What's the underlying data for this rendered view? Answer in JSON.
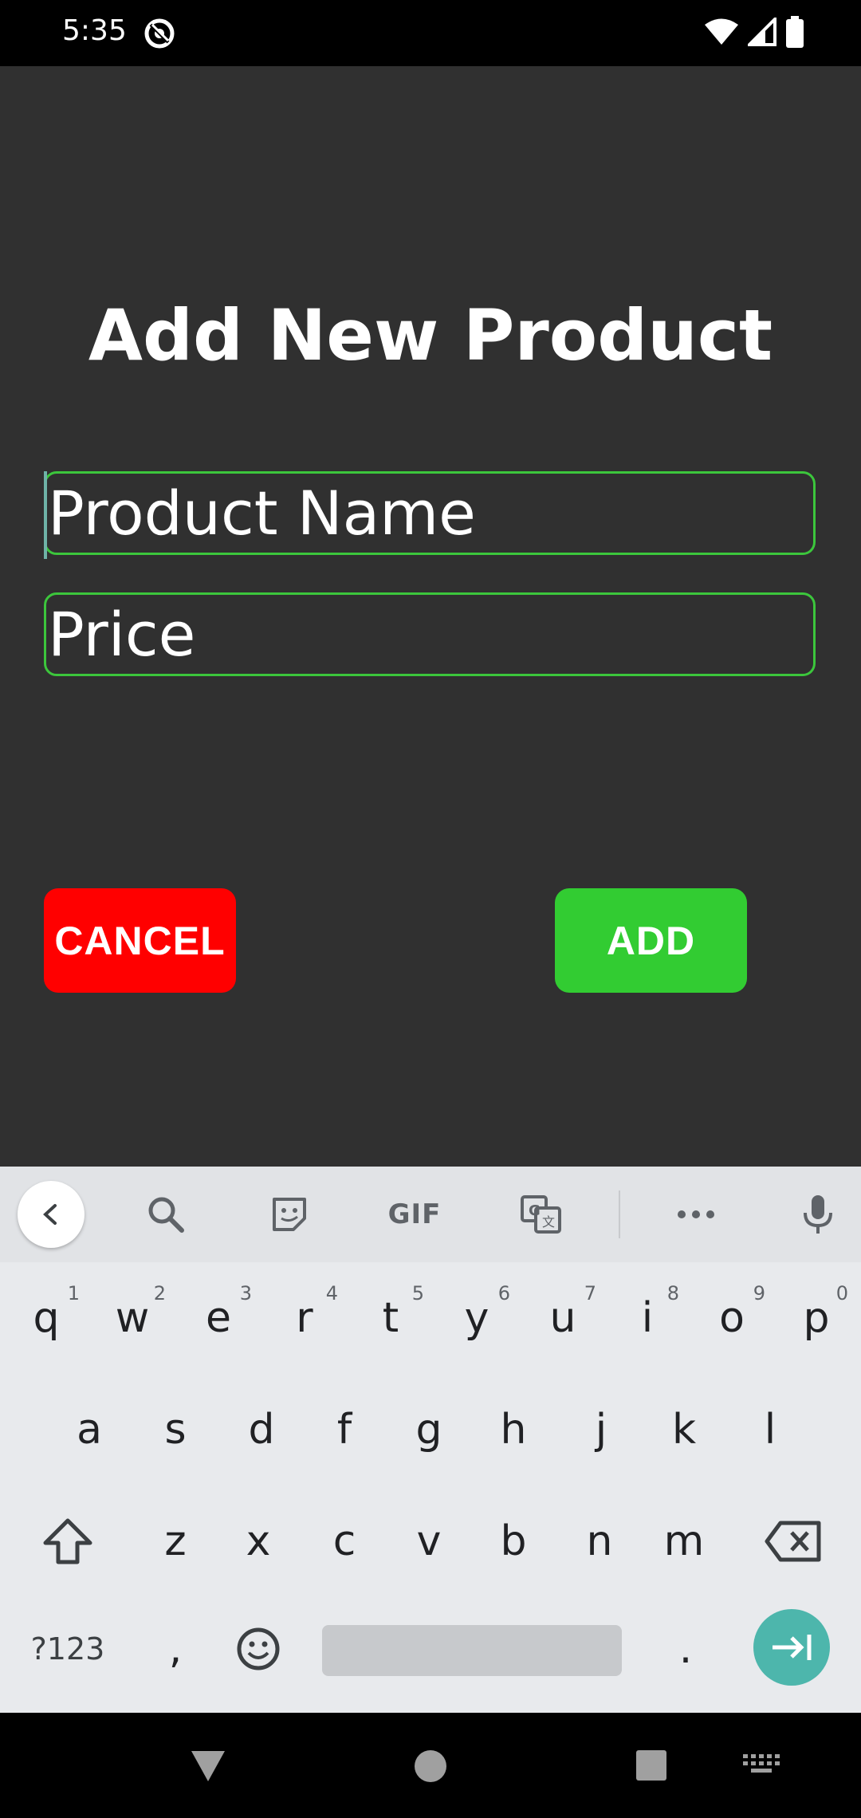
{
  "status_bar": {
    "time": "5:35",
    "app_icon": "do-not-disturb-icon",
    "icons": [
      "wifi-icon",
      "cellular-signal-icon",
      "battery-icon"
    ]
  },
  "form": {
    "title": "Add New Product",
    "product_name_placeholder": "Product Name",
    "price_placeholder": "Price",
    "cancel_label": "CANCEL",
    "add_label": "ADD"
  },
  "colors": {
    "background": "#303030",
    "field_border": "#3cc63c",
    "cancel": "#ff0000",
    "add": "#32cc32",
    "keyboard_action": "#4db6ac"
  },
  "keyboard": {
    "toolbar": {
      "gif_label": "GIF",
      "icons": [
        "back-chevron-icon",
        "search-icon",
        "sticker-icon",
        "gif-icon",
        "translate-icon",
        "more-icon",
        "microphone-icon"
      ]
    },
    "row1": [
      {
        "k": "q",
        "n": "1"
      },
      {
        "k": "w",
        "n": "2"
      },
      {
        "k": "e",
        "n": "3"
      },
      {
        "k": "r",
        "n": "4"
      },
      {
        "k": "t",
        "n": "5"
      },
      {
        "k": "y",
        "n": "6"
      },
      {
        "k": "u",
        "n": "7"
      },
      {
        "k": "i",
        "n": "8"
      },
      {
        "k": "o",
        "n": "9"
      },
      {
        "k": "p",
        "n": "0"
      }
    ],
    "row2": [
      "a",
      "s",
      "d",
      "f",
      "g",
      "h",
      "j",
      "k",
      "l"
    ],
    "row3": [
      "z",
      "x",
      "c",
      "v",
      "b",
      "n",
      "m"
    ],
    "symbols_label": "?123",
    "comma": ",",
    "period": "."
  },
  "nav_bar": {
    "icons": [
      "back-triangle-icon",
      "home-circle-icon",
      "recents-square-icon",
      "keyboard-switch-icon"
    ]
  }
}
